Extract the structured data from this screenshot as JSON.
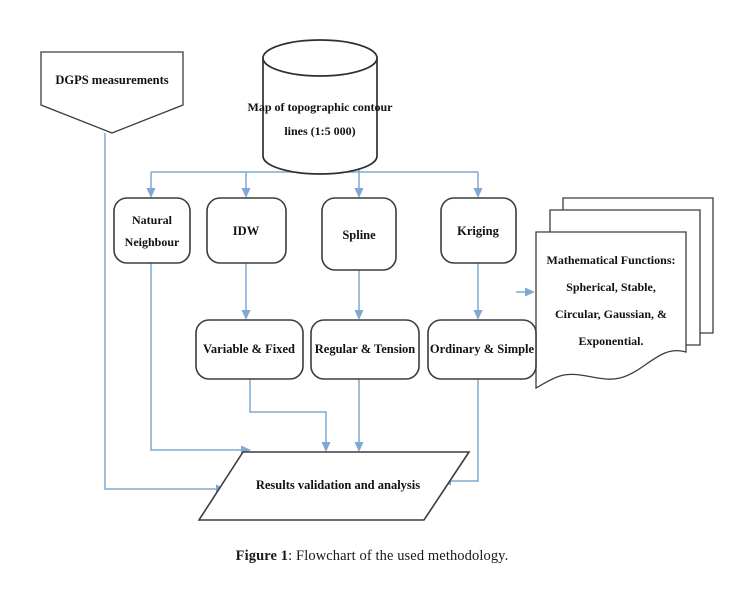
{
  "figure": {
    "caption_label": "Figure 1",
    "caption_separator": ":",
    "caption_text": "Flowchart of the used methodology."
  },
  "colors": {
    "connector": "#7fa8d4",
    "node_border": "#3d3d3d",
    "node_fill": "#ffffff",
    "text": "#111111",
    "background": "#ffffff"
  },
  "diagram": {
    "title": "Flowchart of the used methodology",
    "nodes": {
      "dgps": {
        "label": "DGPS measurements",
        "shape": "pentagon-down"
      },
      "map_source": {
        "label_line1": "Map of topographic  contour",
        "label_line2": "lines (1:5 000)",
        "shape": "cylinder"
      },
      "natural_neighbour": {
        "label_line1": "Natural",
        "label_line2": "Neighbour",
        "shape": "rounded-rect"
      },
      "idw": {
        "label": "IDW",
        "shape": "rounded-rect"
      },
      "spline": {
        "label": "Spline",
        "shape": "rounded-rect"
      },
      "kriging": {
        "label": "Kriging",
        "shape": "rounded-rect"
      },
      "math_functions": {
        "label_line1": "Mathematical Functions:",
        "label_line2": "Spherical, Stable,",
        "label_line3": "Circular,  Gaussian, &",
        "label_line4": "Exponential.",
        "shape": "multi-document"
      },
      "variable_fixed": {
        "label": "Variable & Fixed",
        "shape": "rounded-rect"
      },
      "regular_tension": {
        "label": "Regular & Tension",
        "shape": "rounded-rect"
      },
      "ordinary_simple": {
        "label": "Ordinary  & Simple",
        "shape": "rounded-rect"
      },
      "results": {
        "label": "Results validation  and  analysis",
        "shape": "parallelogram"
      }
    },
    "edges": [
      {
        "from": "map_source",
        "to": "natural_neighbour"
      },
      {
        "from": "map_source",
        "to": "idw"
      },
      {
        "from": "map_source",
        "to": "spline"
      },
      {
        "from": "map_source",
        "to": "kriging"
      },
      {
        "from": "kriging",
        "to": "math_functions"
      },
      {
        "from": "idw",
        "to": "variable_fixed"
      },
      {
        "from": "spline",
        "to": "regular_tension"
      },
      {
        "from": "kriging",
        "to": "ordinary_simple"
      },
      {
        "from": "math_functions",
        "to": "ordinary_simple"
      },
      {
        "from": "dgps",
        "to": "results"
      },
      {
        "from": "natural_neighbour",
        "to": "results"
      },
      {
        "from": "variable_fixed",
        "to": "results"
      },
      {
        "from": "regular_tension",
        "to": "results"
      },
      {
        "from": "ordinary_simple",
        "to": "results"
      }
    ]
  }
}
